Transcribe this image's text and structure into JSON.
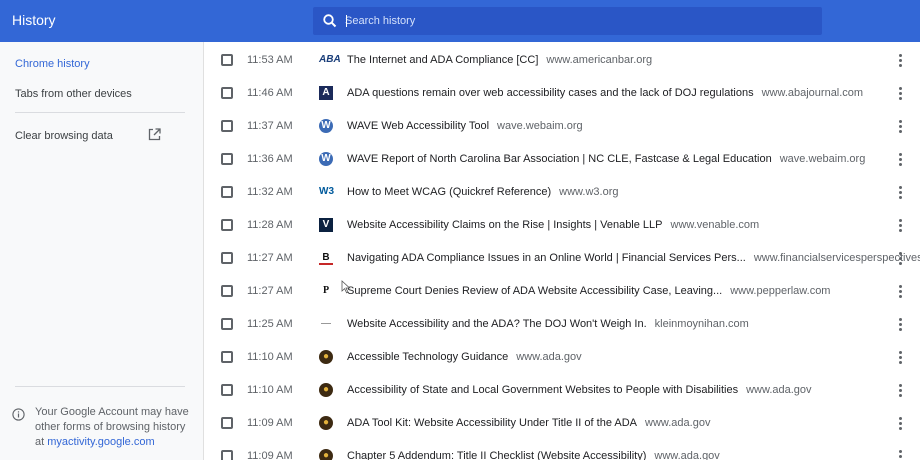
{
  "header": {
    "title": "History",
    "search_placeholder": "Search history",
    "accent_color": "#3367d6"
  },
  "sidebar": {
    "items": [
      {
        "label": "Chrome history",
        "active": true
      },
      {
        "label": "Tabs from other devices",
        "active": false
      },
      {
        "label": "Clear browsing data",
        "active": false,
        "icon": "open-in-new-icon"
      }
    ],
    "footer": {
      "icon": "info-icon",
      "text": "Your Google Account may have other forms of browsing history at",
      "link": "myactivity.google.com"
    }
  },
  "history": [
    {
      "time": "11:53 AM",
      "title": "The Internet and ADA Compliance [CC]",
      "domain": "www.americanbar.org",
      "favicon": "aba-icon",
      "glyph": "ABA"
    },
    {
      "time": "11:46 AM",
      "title": "ADA questions remain over web accessibility cases and the lack of DOJ regulations",
      "domain": "www.abajournal.com",
      "favicon": "aba-journal-icon",
      "glyph": "A"
    },
    {
      "time": "11:37 AM",
      "title": "WAVE Web Accessibility Tool",
      "domain": "wave.webaim.org",
      "favicon": "wave-icon",
      "glyph": "W"
    },
    {
      "time": "11:36 AM",
      "title": "WAVE Report of North Carolina Bar Association | NC CLE, Fastcase & Legal Education",
      "domain": "wave.webaim.org",
      "favicon": "wave-icon",
      "glyph": "W"
    },
    {
      "time": "11:32 AM",
      "title": "How to Meet WCAG (Quickref Reference)",
      "domain": "www.w3.org",
      "favicon": "w3c-icon",
      "glyph": "W3"
    },
    {
      "time": "11:28 AM",
      "title": "Website Accessibility Claims on the Rise | Insights | Venable LLP",
      "domain": "www.venable.com",
      "favicon": "venable-icon",
      "glyph": "V"
    },
    {
      "time": "11:27 AM",
      "title": "Navigating ADA Compliance Issues in an Online World | Financial Services Pers...",
      "domain": "www.financialservicesperspectives.com",
      "favicon": "b-icon",
      "glyph": "B"
    },
    {
      "time": "11:27 AM",
      "title": "Supreme Court Denies Review of ADA Website Accessibility Case, Leaving...",
      "domain": "www.pepperlaw.com",
      "favicon": "pepper-icon",
      "glyph": "P"
    },
    {
      "time": "11:25 AM",
      "title": "Website Accessibility and the ADA? The DOJ Won't Weigh In.",
      "domain": "kleinmoynihan.com",
      "favicon": "kleinmoynihan-icon",
      "glyph": "—"
    },
    {
      "time": "11:10 AM",
      "title": "Accessible Technology Guidance",
      "domain": "www.ada.gov",
      "favicon": "ada-gov-icon",
      "glyph": "●"
    },
    {
      "time": "11:10 AM",
      "title": "Accessibility of State and Local Government Websites to People with Disabilities",
      "domain": "www.ada.gov",
      "favicon": "ada-gov-icon",
      "glyph": "●"
    },
    {
      "time": "11:09 AM",
      "title": "ADA Tool Kit: Website Accessibility Under Title II of the ADA",
      "domain": "www.ada.gov",
      "favicon": "ada-gov-icon",
      "glyph": "●"
    },
    {
      "time": "11:09 AM",
      "title": "Chapter 5 Addendum: Title II Checklist (Website Accessibility)",
      "domain": "www.ada.gov",
      "favicon": "ada-gov-icon",
      "glyph": "●"
    }
  ]
}
